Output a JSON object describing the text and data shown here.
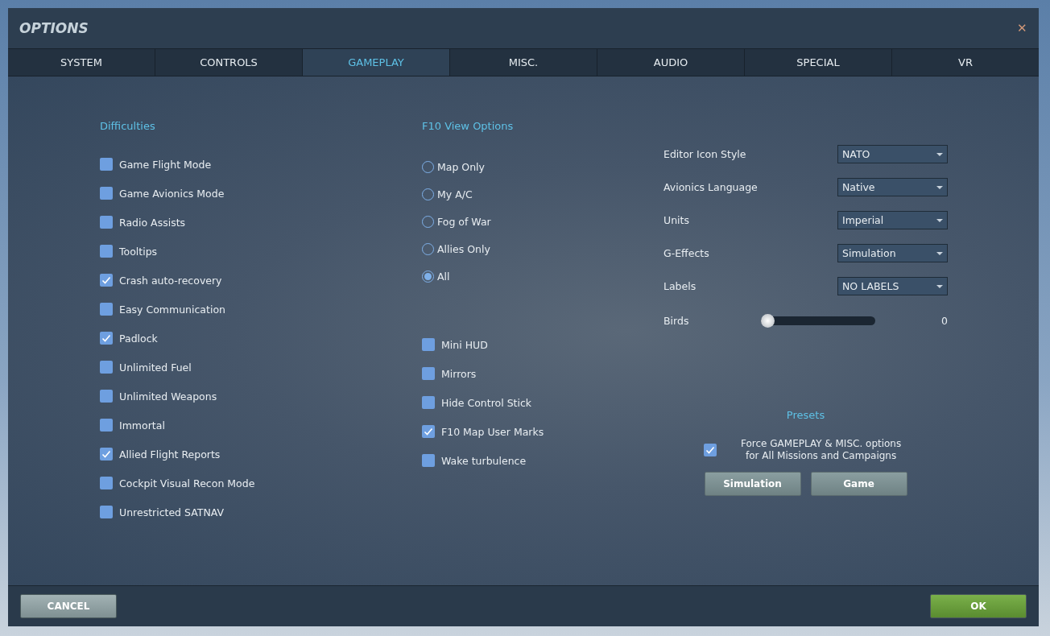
{
  "window": {
    "title": "OPTIONS",
    "close": "✕"
  },
  "tabs": [
    {
      "label": "SYSTEM",
      "selected": false
    },
    {
      "label": "CONTROLS",
      "selected": false
    },
    {
      "label": "GAMEPLAY",
      "selected": true
    },
    {
      "label": "MISC.",
      "selected": false
    },
    {
      "label": "AUDIO",
      "selected": false
    },
    {
      "label": "SPECIAL",
      "selected": false
    },
    {
      "label": "VR",
      "selected": false
    }
  ],
  "difficulties": {
    "heading": "Difficulties",
    "items": [
      {
        "label": "Game Flight Mode",
        "checked": false
      },
      {
        "label": "Game Avionics Mode",
        "checked": false
      },
      {
        "label": "Radio Assists",
        "checked": false
      },
      {
        "label": "Tooltips",
        "checked": false
      },
      {
        "label": "Crash auto-recovery",
        "checked": true
      },
      {
        "label": "Easy Communication",
        "checked": false
      },
      {
        "label": "Padlock",
        "checked": true
      },
      {
        "label": "Unlimited Fuel",
        "checked": false
      },
      {
        "label": "Unlimited Weapons",
        "checked": false
      },
      {
        "label": "Immortal",
        "checked": false
      },
      {
        "label": "Allied Flight Reports",
        "checked": true
      },
      {
        "label": "Cockpit Visual Recon Mode",
        "checked": false
      },
      {
        "label": "Unrestricted SATNAV",
        "checked": false
      }
    ]
  },
  "f10_view": {
    "heading": "F10 View Options",
    "options": [
      {
        "label": "Map Only",
        "selected": false
      },
      {
        "label": "My A/C",
        "selected": false
      },
      {
        "label": "Fog of War",
        "selected": false
      },
      {
        "label": "Allies Only",
        "selected": false
      },
      {
        "label": "All",
        "selected": true
      }
    ]
  },
  "view_checks": [
    {
      "label": "Mini HUD",
      "checked": false
    },
    {
      "label": "Mirrors",
      "checked": false
    },
    {
      "label": "Hide Control Stick",
      "checked": false
    },
    {
      "label": "F10 Map User Marks",
      "checked": true
    },
    {
      "label": "Wake turbulence",
      "checked": false
    }
  ],
  "settings": [
    {
      "label": "Editor Icon Style",
      "value": "NATO"
    },
    {
      "label": "Avionics Language",
      "value": "Native"
    },
    {
      "label": "Units",
      "value": "Imperial"
    },
    {
      "label": "G-Effects",
      "value": "Simulation"
    },
    {
      "label": "Labels",
      "value": "NO LABELS"
    }
  ],
  "birds": {
    "label": "Birds",
    "level": 0,
    "reading": "0"
  },
  "presets": {
    "heading": "Presets",
    "force_label": "Force GAMEPLAY & MISC. options",
    "force_label_2": "for All Missions and Campaigns",
    "force_checked": true,
    "buttons": [
      "Simulation",
      "Game"
    ]
  },
  "footer": {
    "cancel": "CANCEL",
    "ok": "OK"
  }
}
